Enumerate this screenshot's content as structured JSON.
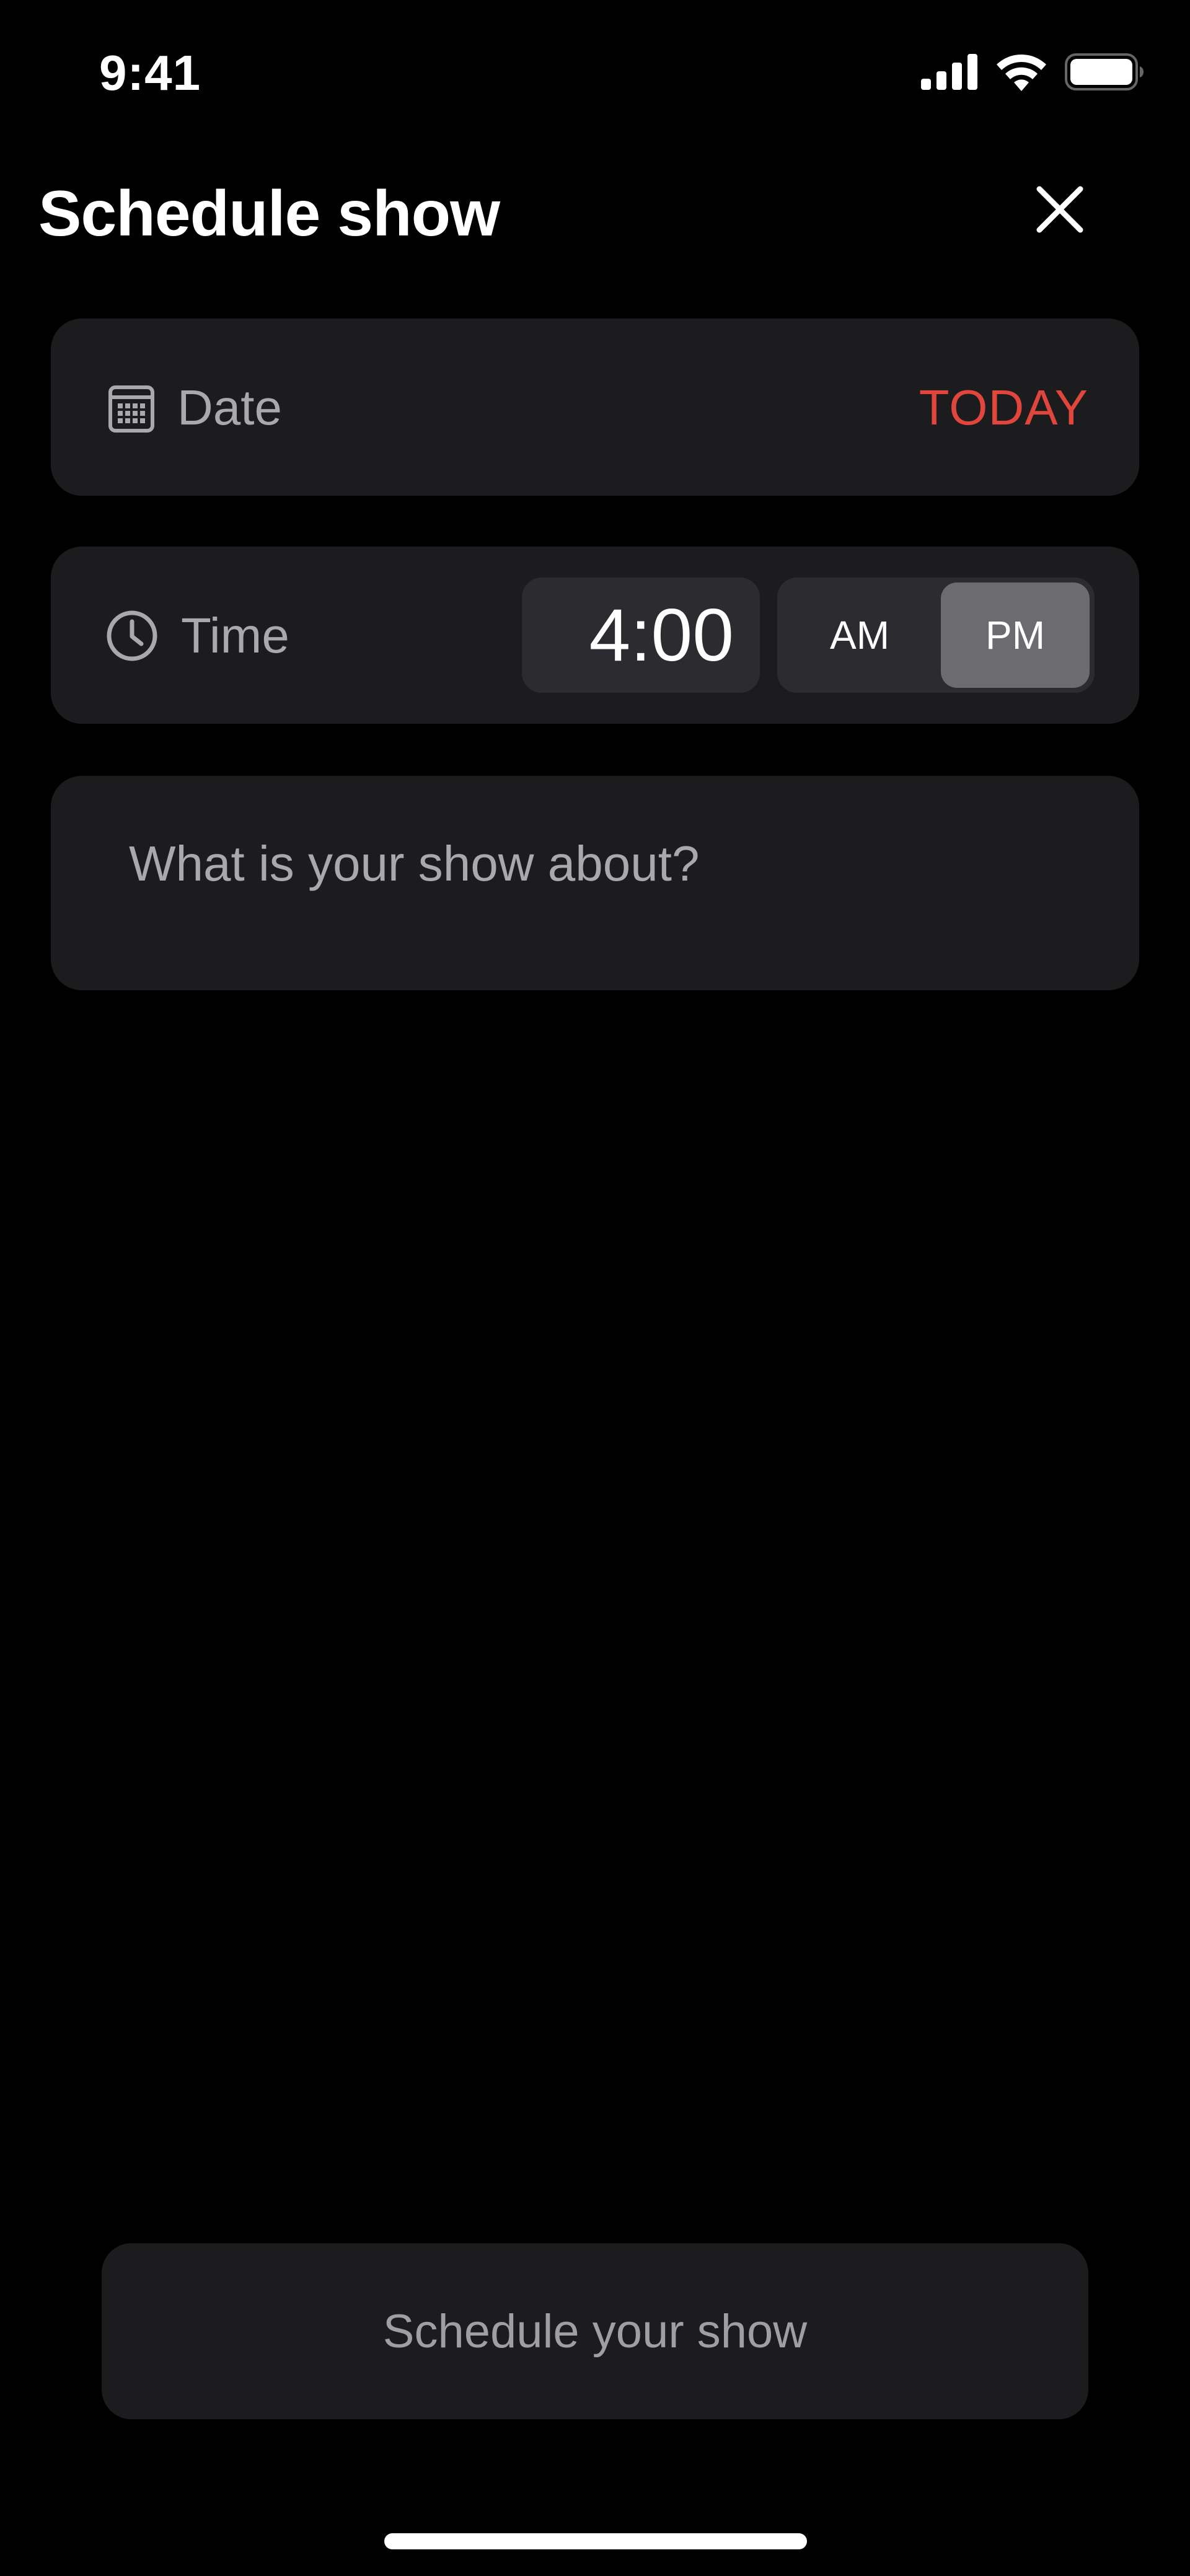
{
  "status_bar": {
    "time": "9:41",
    "icons": [
      "cellular-signal-icon",
      "wifi-icon",
      "battery-icon"
    ]
  },
  "header": {
    "title": "Schedule show",
    "close_icon": "close-icon"
  },
  "date_row": {
    "icon": "calendar-icon",
    "label": "Date",
    "value": "TODAY",
    "value_color": "#e0463b"
  },
  "time_row": {
    "icon": "clock-icon",
    "label": "Time",
    "value": "4:00",
    "meridiem_options": [
      "AM",
      "PM"
    ],
    "meridiem_selected": "PM"
  },
  "about": {
    "placeholder": "What is your show about?"
  },
  "footer": {
    "button_label": "Schedule your show"
  },
  "colors": {
    "background": "#000000",
    "card": "#1c1c1f",
    "accent": "#e0463b",
    "segment_selected": "#6b6b70"
  }
}
